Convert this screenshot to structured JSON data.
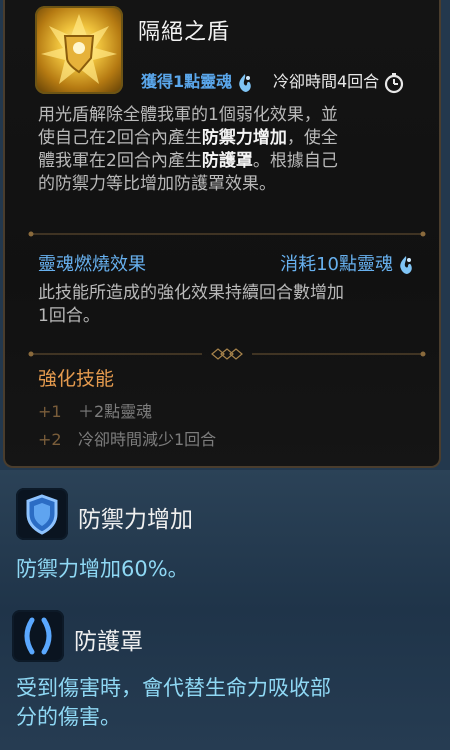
{
  "skill": {
    "title": "隔絕之盾",
    "soul_gain": "獲得1點靈魂",
    "cooldown": "冷卻時間4回合",
    "description_lines": [
      {
        "pre": "用光盾解除全體我軍的1個弱化效果，並",
        "bold": "",
        "post": ""
      },
      {
        "pre": "使自己在2回合內產生",
        "bold": "防禦力增加",
        "post": "，使全"
      },
      {
        "pre": "體我軍在2回合內產生",
        "bold": "防護罩",
        "post": "。根據自己"
      },
      {
        "pre": "的防禦力等比增加防護罩效果。",
        "bold": "",
        "post": ""
      }
    ]
  },
  "soul_burn": {
    "label": "靈魂燃燒效果",
    "cost": "消耗10點靈魂",
    "description_lines": [
      "此技能所造成的強化效果持續回合數增加",
      "1回合。"
    ]
  },
  "enhance": {
    "title": "強化技能",
    "items": [
      {
        "level": "+1",
        "text": "＋2點靈魂"
      },
      {
        "level": "+2",
        "text": "冷卻時間減少1回合"
      }
    ]
  },
  "buffs": [
    {
      "name": "防禦力增加",
      "icon": "shield-icon",
      "description_lines": [
        "防禦力增加60%。"
      ]
    },
    {
      "name": "防護罩",
      "icon": "barrier-icon",
      "description_lines": [
        "受到傷害時，會代替生命力吸收部",
        "分的傷害。"
      ]
    }
  ],
  "colors": {
    "skill_blue": "#5aa6ea",
    "enhance_orange": "#e49a4e",
    "buff_desc_cyan": "#8fd8f4"
  }
}
